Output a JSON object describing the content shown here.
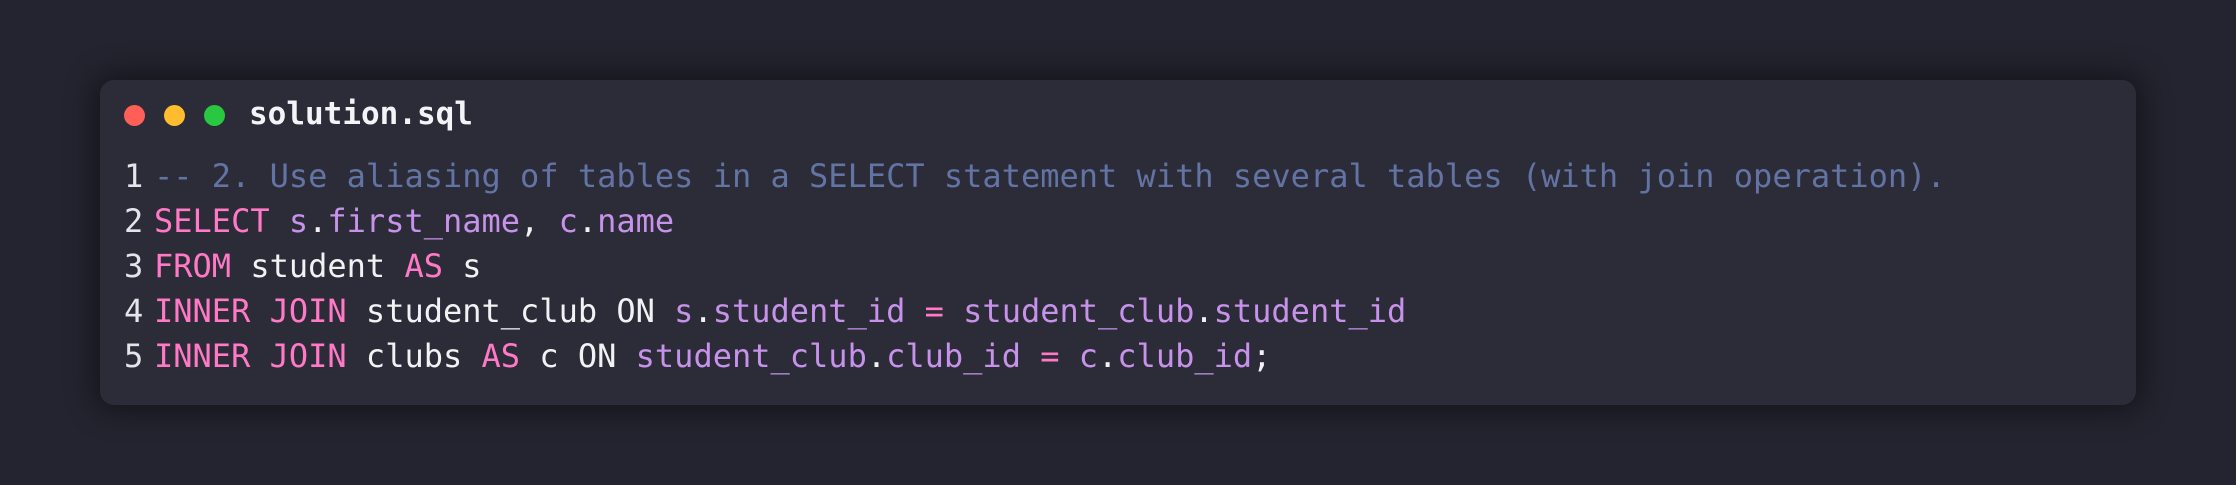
{
  "window": {
    "filename": "solution.sql",
    "controls": {
      "close_color": "#ff5f57",
      "minimize_color": "#febc2e",
      "maximize_color": "#28c840"
    }
  },
  "colors": {
    "background": "#23242f",
    "editor": "#2b2c38",
    "comment": "#6273a4",
    "keyword": "#ff79c6",
    "identifier": "#c792ea",
    "plain": "#f2f2f5"
  },
  "code": {
    "lines": [
      {
        "number": "1",
        "tokens": [
          {
            "type": "comment",
            "text": "-- 2. Use aliasing of tables in a SELECT statement with several tables (with join operation)."
          }
        ]
      },
      {
        "number": "2",
        "tokens": [
          {
            "type": "kw",
            "text": "SELECT"
          },
          {
            "type": "plain",
            "text": " "
          },
          {
            "type": "id",
            "text": "s"
          },
          {
            "type": "punct",
            "text": "."
          },
          {
            "type": "id",
            "text": "first_name"
          },
          {
            "type": "punct",
            "text": ", "
          },
          {
            "type": "id",
            "text": "c"
          },
          {
            "type": "punct",
            "text": "."
          },
          {
            "type": "id",
            "text": "name"
          }
        ]
      },
      {
        "number": "3",
        "tokens": [
          {
            "type": "kw",
            "text": "FROM"
          },
          {
            "type": "plain",
            "text": " student "
          },
          {
            "type": "kw",
            "text": "AS"
          },
          {
            "type": "plain",
            "text": " s"
          }
        ]
      },
      {
        "number": "4",
        "tokens": [
          {
            "type": "kw",
            "text": "INNER JOIN"
          },
          {
            "type": "plain",
            "text": " student_club ON "
          },
          {
            "type": "id",
            "text": "s"
          },
          {
            "type": "punct",
            "text": "."
          },
          {
            "type": "id",
            "text": "student_id"
          },
          {
            "type": "plain",
            "text": " "
          },
          {
            "type": "kw",
            "text": "="
          },
          {
            "type": "plain",
            "text": " "
          },
          {
            "type": "id",
            "text": "student_club"
          },
          {
            "type": "punct",
            "text": "."
          },
          {
            "type": "id",
            "text": "student_id"
          }
        ]
      },
      {
        "number": "5",
        "tokens": [
          {
            "type": "kw",
            "text": "INNER JOIN"
          },
          {
            "type": "plain",
            "text": " clubs "
          },
          {
            "type": "kw",
            "text": "AS"
          },
          {
            "type": "plain",
            "text": " c ON "
          },
          {
            "type": "id",
            "text": "student_club"
          },
          {
            "type": "punct",
            "text": "."
          },
          {
            "type": "id",
            "text": "club_id"
          },
          {
            "type": "plain",
            "text": " "
          },
          {
            "type": "kw",
            "text": "="
          },
          {
            "type": "plain",
            "text": " "
          },
          {
            "type": "id",
            "text": "c"
          },
          {
            "type": "punct",
            "text": "."
          },
          {
            "type": "id",
            "text": "club_id"
          },
          {
            "type": "punct",
            "text": ";"
          }
        ]
      }
    ]
  }
}
